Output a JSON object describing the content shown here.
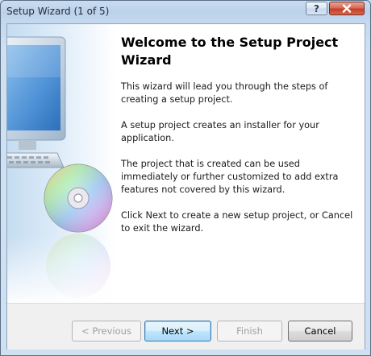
{
  "window": {
    "title": "Setup Wizard (1 of 5)",
    "help_glyph": "?",
    "close_icon": "close-icon"
  },
  "content": {
    "heading": "Welcome to the Setup Project Wizard",
    "paragraphs": [
      "This wizard will lead you through the steps of creating a setup project.",
      "A setup project creates an installer for your application.",
      "The project that is created can be used immediately or further customized to add extra features not covered by this wizard.",
      "Click Next to create a new setup project, or Cancel to exit the wizard."
    ]
  },
  "buttons": {
    "previous": "< Previous",
    "next": "Next >",
    "finish": "Finish",
    "cancel": "Cancel"
  },
  "colors": {
    "close_red": "#c1412b",
    "default_button_border": "#3c7fb1"
  }
}
